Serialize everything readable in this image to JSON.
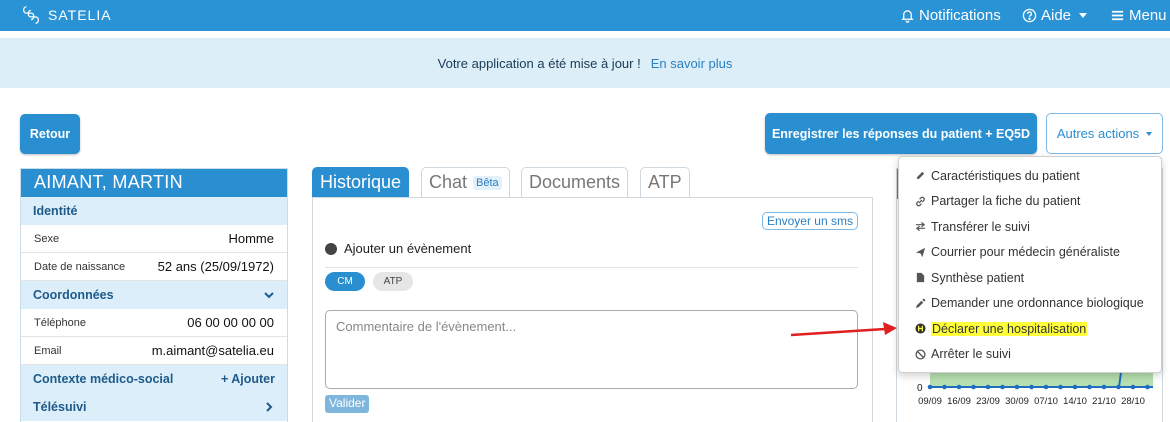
{
  "navbar": {
    "brand": "SATELIA",
    "notifications": "Notifications",
    "help": "Aide",
    "menu": "Menu"
  },
  "banner": {
    "message": "Votre application a été mise à jour !",
    "link": "En savoir plus"
  },
  "actions": {
    "back": "Retour",
    "record_responses": "Enregistrer les réponses du patient + EQ5D",
    "other_actions": "Autres actions"
  },
  "patient": {
    "name": "AIMANT,  MARTIN",
    "identity_header": "Identité",
    "sex_label": "Sexe",
    "sex_value": "Homme",
    "dob_label": "Date de naissance",
    "dob_value": "52 ans (25/09/1972)",
    "contact_header": "Coordonnées",
    "phone_label": "Téléphone",
    "phone_value": "06 00 00 00 00",
    "email_label": "Email",
    "email_value": "m.aimant@satelia.eu",
    "context_header": "Contexte médico-social",
    "context_add": "+ Ajouter",
    "telesuivi_header": "Télésuivi"
  },
  "tabs": {
    "history": "Historique",
    "chat": "Chat",
    "chat_badge": "Bêta",
    "documents": "Documents",
    "atp": "ATP"
  },
  "history": {
    "sms_button": "Envoyer un sms",
    "add_event": "Ajouter un évènement",
    "pill_cm": "CM",
    "pill_atp": "ATP",
    "comment_placeholder": "Commentaire de l'évènement...",
    "validate": "Valider"
  },
  "dropdown": {
    "items": [
      {
        "label": "Caractéristiques du patient",
        "icon": "pencil-icon"
      },
      {
        "label": "Partager la fiche du patient",
        "icon": "link-icon"
      },
      {
        "label": "Transférer le suivi",
        "icon": "transfer-icon"
      },
      {
        "label": "Courrier pour médecin généraliste",
        "icon": "send-icon"
      },
      {
        "label": "Synthèse patient",
        "icon": "file-icon"
      },
      {
        "label": "Demander une ordonnance biologique",
        "icon": "eyedropper-icon"
      },
      {
        "label": "Déclarer une hospitalisation",
        "icon": "hospital-icon",
        "highlighted": true
      },
      {
        "label": "Arrêter le suivi",
        "icon": "ban-icon"
      }
    ]
  },
  "chart_data": {
    "type": "area",
    "categories": [
      "09/09",
      "16/09",
      "23/09",
      "30/09",
      "07/10",
      "14/10",
      "21/10",
      "28/10"
    ],
    "y_tick_visible": "0",
    "color_fill": "#b7e0b0",
    "color_line": "#1f6fbf"
  },
  "colors": {
    "navbar": "#2a93d5",
    "primary": "#2a8fd1",
    "banner": "#dceef8",
    "highlight": "#ffff3a",
    "arrow": "#e02020"
  }
}
